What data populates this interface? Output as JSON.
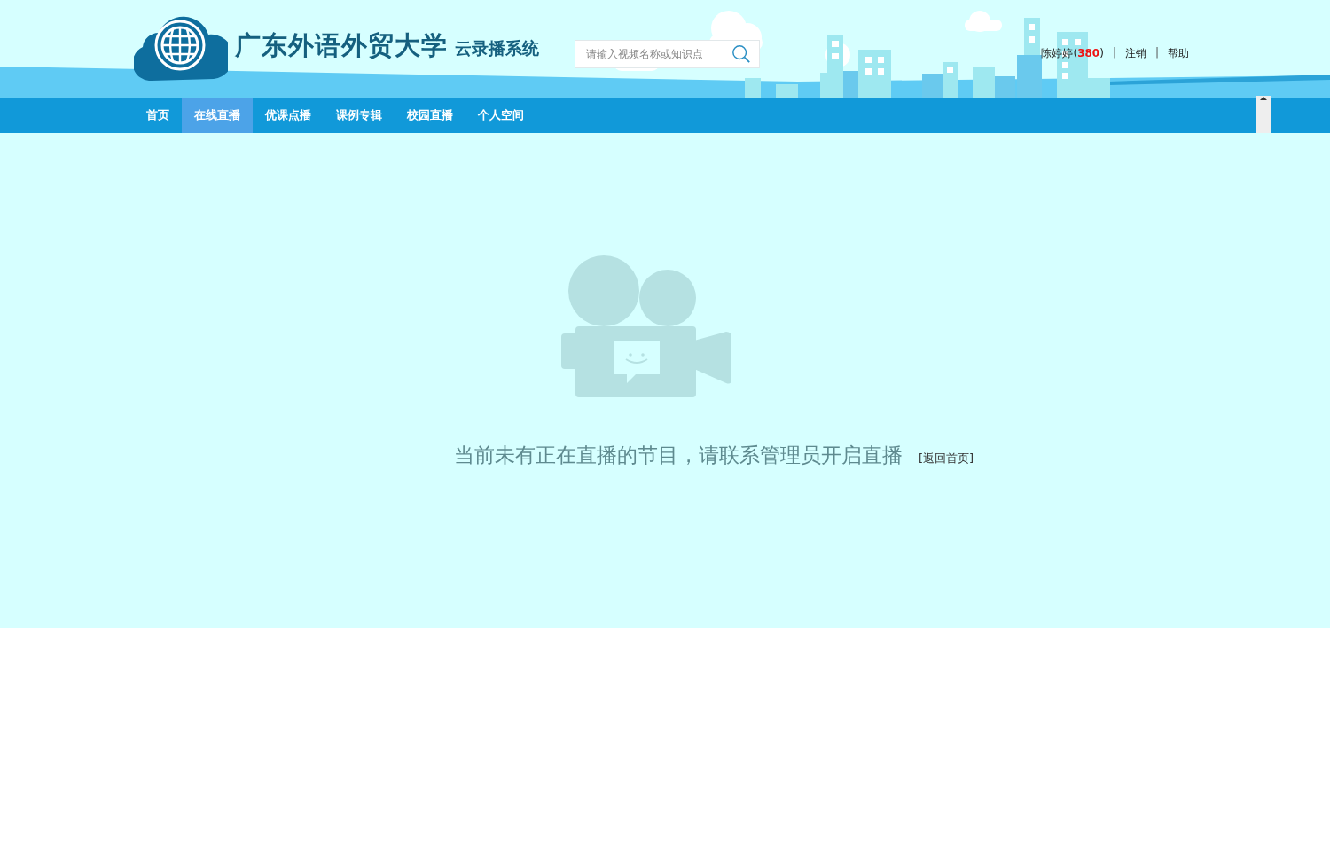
{
  "header": {
    "logo_title": "广东外语外贸大学",
    "logo_subtitle": "云录播系统",
    "search": {
      "placeholder": "请输入视频名称或知识点"
    },
    "user_bar": [
      {
        "kind": "user",
        "text": "陈婷婷(**380**)"
      },
      {
        "kind": "separator",
        "text": "|"
      },
      {
        "kind": "link",
        "text": "注销"
      },
      {
        "kind": "separator",
        "text": "|"
      },
      {
        "kind": "link",
        "text": "帮助"
      }
    ]
  },
  "nav": [
    {
      "label": "首页",
      "selected": false
    },
    {
      "label": "在线直播",
      "selected": true
    },
    {
      "label": "优课点播",
      "selected": false
    },
    {
      "label": "课例专辑",
      "selected": false
    },
    {
      "label": "校园直播",
      "selected": false
    },
    {
      "label": "个人空间",
      "selected": false
    }
  ],
  "empty_state": {
    "message": "当前未有正在直播的节目，请联系管理员开启直播",
    "link": "[返回首页]"
  }
}
